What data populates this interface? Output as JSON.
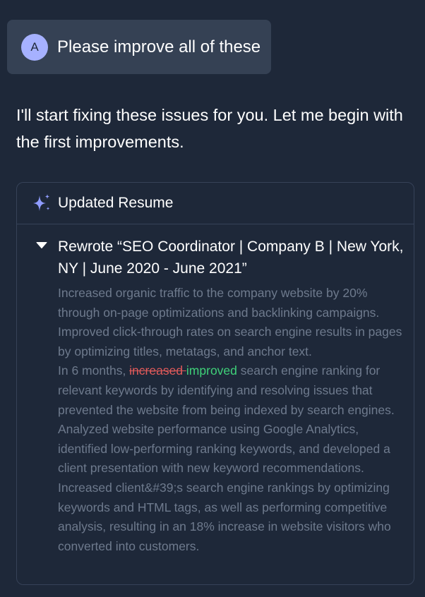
{
  "user_message": {
    "avatar_initial": "A",
    "text": "Please improve all of these"
  },
  "assistant_message": {
    "text": "I'll start fixing these issues for you. Let me begin with the first improvements."
  },
  "card": {
    "icon": "sparkle-icon",
    "title": "Updated Resume",
    "section": {
      "expanded": true,
      "title": "Rewrote “SEO Coordinator | Company B | New York, NY | June 2020 - June 2021”",
      "lines": {
        "p1": "Increased organic traffic to the company website by 20% through on-page optimizations and backlinking campaigns.",
        "p2": "Improved click-through rates on search engine results in pages by optimizing titles, metatags, and anchor text.",
        "p3_prefix": "In 6 months, ",
        "p3_deleted": "increased ",
        "p3_inserted": "improved",
        "p3_suffix": " search engine ranking for relevant keywords by identifying and resolving issues that prevented the website from being indexed by search engines.",
        "p4": "Analyzed website performance using Google Analytics, identified low-performing ranking keywords, and developed a client presentation with new keyword recommendations.",
        "p5": "Increased client&#39;s search engine rankings by optimizing keywords and HTML tags, as well as performing competitive analysis, resulting in an 18% increase in website visitors who converted into customers."
      }
    }
  },
  "colors": {
    "background": "#1e2839",
    "user_bubble": "#354154",
    "avatar": "#a6b1ff",
    "muted_text": "#6e7a8d",
    "deleted": "#e05a5a",
    "inserted": "#3fd179"
  }
}
